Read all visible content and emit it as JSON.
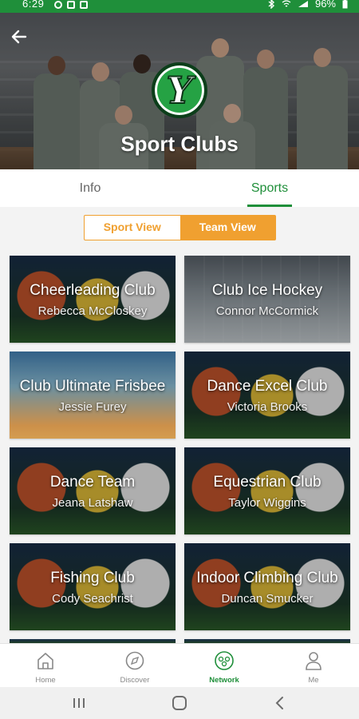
{
  "status_bar": {
    "time": "6:29",
    "battery": "96%"
  },
  "header": {
    "title": "Sport Clubs",
    "logo_letter": "Y"
  },
  "tabs": [
    {
      "label": "Info"
    },
    {
      "label": "Sports"
    }
  ],
  "active_tab": "Sports",
  "view_toggle": {
    "sport_view_label": "Sport View",
    "team_view_label": "Team View",
    "selected": "Team View"
  },
  "clubs": [
    {
      "title": "Cheerleading Club",
      "contact": "Rebecca McCloskey",
      "image": "sports-balls"
    },
    {
      "title": "Club Ice Hockey",
      "contact": "Connor McCormick",
      "image": "ice-hockey"
    },
    {
      "title": "Club Ultimate Frisbee",
      "contact": "Jessie Furey",
      "image": "frisbee-sunset"
    },
    {
      "title": "Dance Excel Club",
      "contact": "Victoria Brooks",
      "image": "sports-balls"
    },
    {
      "title": "Dance Team",
      "contact": "Jeana Latshaw",
      "image": "sports-balls"
    },
    {
      "title": "Equestrian Club",
      "contact": "Taylor Wiggins",
      "image": "sports-balls"
    },
    {
      "title": "Fishing Club",
      "contact": "Cody Seachrist",
      "image": "sports-balls"
    },
    {
      "title": "Indoor Climbing Club",
      "contact": "Duncan Smucker",
      "image": "sports-balls"
    }
  ],
  "bottom_nav": [
    {
      "label": "Home",
      "icon": "home-icon"
    },
    {
      "label": "Discover",
      "icon": "compass-icon"
    },
    {
      "label": "Network",
      "icon": "network-icon"
    },
    {
      "label": "Me",
      "icon": "person-icon"
    }
  ],
  "active_nav": "Network",
  "colors": {
    "brand_green": "#1f8f3a",
    "accent_orange": "#f0a030"
  }
}
